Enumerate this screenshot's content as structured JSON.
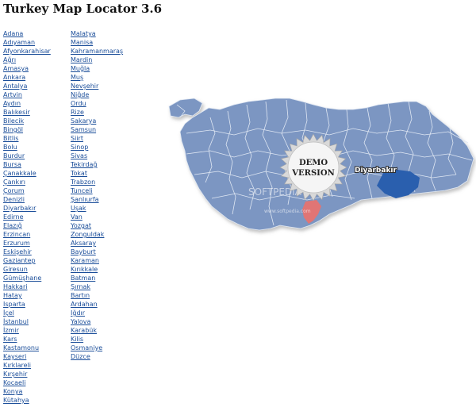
{
  "title": "Turkey Map Locator 3.6",
  "provinces_col1": [
    "Adana",
    "Adıyaman",
    "Afyonkarahisar",
    "Ağrı",
    "Amasya",
    "Ankara",
    "Antalya",
    "Artvin",
    "Aydın",
    "Balıkesir",
    "Bilecik",
    "Bingöl",
    "Bitlis",
    "Bolu",
    "Burdur",
    "Bursa",
    "Çanakkale",
    "Çankırı",
    "Çorum",
    "Denizli",
    "Diyarbakır",
    "Edirne",
    "Elazığ",
    "Erzincan",
    "Erzurum",
    "Eskişehir",
    "Gaziantep",
    "Giresun",
    "Gümüşhane",
    "Hakkari",
    "Hatay",
    "Isparta",
    "İçel",
    "İstanbul",
    "İzmir",
    "Kars",
    "Kastamonu",
    "Kayseri",
    "Kırklareli",
    "Kırşehir",
    "Kocaeli",
    "Konya",
    "Kütahya"
  ],
  "provinces_col2": [
    "Malatya",
    "Manisa",
    "Kahramanmaraş",
    "Mardin",
    "Muğla",
    "Muş",
    "Nevşehir",
    "Niğde",
    "Ordu",
    "Rize",
    "Sakarya",
    "Samsun",
    "Siirt",
    "Sinop",
    "Sivas",
    "Tekirdağ",
    "Tokat",
    "Trabzon",
    "Tunceli",
    "Şanlıurfa",
    "Uşak",
    "Van",
    "Yozgat",
    "Zonguldak",
    "Aksaray",
    "Bayburt",
    "Karaman",
    "Kırıkkale",
    "Batman",
    "Şırnak",
    "Bartın",
    "Ardahan",
    "Iğdır",
    "Yalova",
    "Karabük",
    "Kilis",
    "Osmaniye",
    "Düzce"
  ],
  "map": {
    "demo_line1": "DEMO",
    "demo_line2": "VERSION",
    "highlight_label": "Diyarbakır",
    "watermark": "SOFTPEDIA",
    "watermark_url": "www.softpedia.com",
    "colors": {
      "land": "#7b96c2",
      "border": "#dfe7f3",
      "highlight": "#2a5fae",
      "hover": "#e07575",
      "shadow": "#c9c9c9"
    }
  }
}
